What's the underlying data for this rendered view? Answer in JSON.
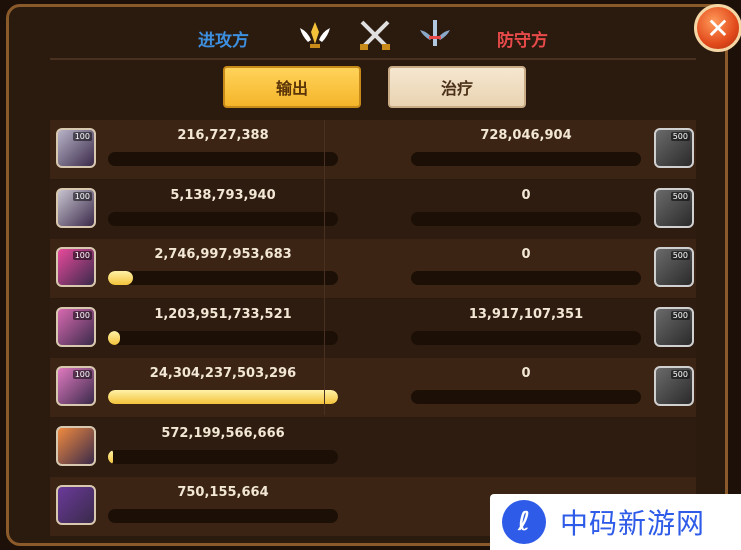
{
  "header": {
    "attacker_label": "进攻方",
    "defender_label": "防守方",
    "icons": [
      "trophy-wings-icon",
      "crossed-swords-icon",
      "sword-wings-icon"
    ]
  },
  "close_button": {
    "icon": "close-icon"
  },
  "tabs": [
    {
      "label": "输出",
      "active": true
    },
    {
      "label": "治疗",
      "active": false
    }
  ],
  "attackers": [
    {
      "value": "216,727,388",
      "fill": 0.0,
      "avatar_level": "100",
      "avatar_color": "#b9b4c8"
    },
    {
      "value": "5,138,793,940",
      "fill": 0.0,
      "avatar_level": "100",
      "avatar_color": "#c8c4d0"
    },
    {
      "value": "2,746,997,953,683",
      "fill": 0.11,
      "avatar_level": "100",
      "avatar_color": "#e84a9c"
    },
    {
      "value": "1,203,951,733,521",
      "fill": 0.05,
      "avatar_level": "100",
      "avatar_color": "#d86ab0"
    },
    {
      "value": "24,304,237,503,296",
      "fill": 1.0,
      "avatar_level": "100",
      "avatar_color": "#e07ac0"
    },
    {
      "value": "572,199,566,666",
      "fill": 0.02,
      "avatar_level": "",
      "avatar_color": "#f08a40"
    },
    {
      "value": "750,155,664",
      "fill": 0.0,
      "avatar_level": "",
      "avatar_color": "#6a3a9a"
    }
  ],
  "defenders": [
    {
      "value": "728,046,904",
      "fill": 0.0,
      "avatar_level": "500"
    },
    {
      "value": "0",
      "fill": 0.0,
      "avatar_level": "500"
    },
    {
      "value": "0",
      "fill": 0.0,
      "avatar_level": "500"
    },
    {
      "value": "13,917,107,351",
      "fill": 0.0,
      "avatar_level": "500"
    },
    {
      "value": "0",
      "fill": 0.0,
      "avatar_level": "500"
    }
  ],
  "watermark": {
    "text": "中码新游网",
    "logo_icon": "leaf-logo-icon"
  },
  "colors": {
    "attacker": "#3d8fe0",
    "defender": "#e84a4a",
    "bar_fill": "#f3c23a",
    "active_tab": "#f5b52a"
  }
}
